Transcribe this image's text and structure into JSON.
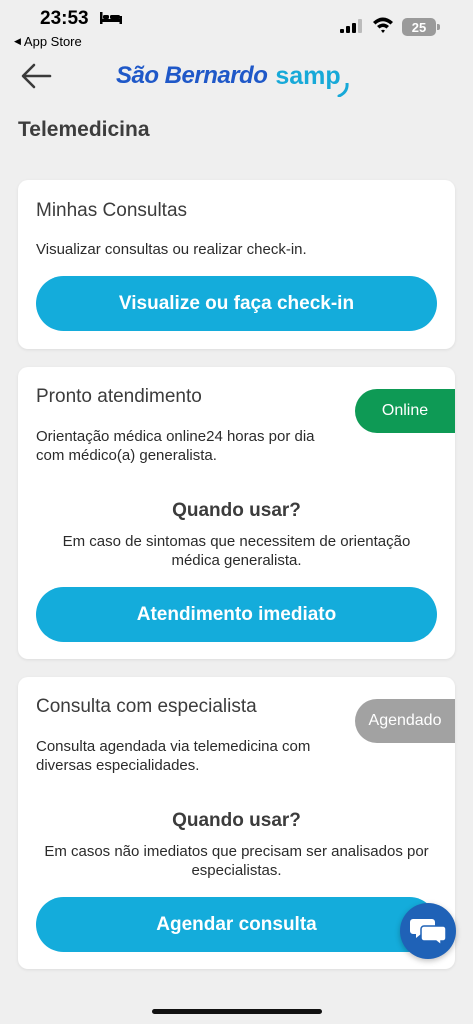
{
  "status_bar": {
    "time": "23:53",
    "back_label": "App Store",
    "battery": "25"
  },
  "header": {
    "logo_part1": "São Bernardo",
    "logo_part2": "samp"
  },
  "page": {
    "title": "Telemedicina"
  },
  "cards": [
    {
      "title": "Minhas Consultas",
      "description": "Visualizar consultas ou realizar check-in.",
      "button": "Visualize ou faça check-in"
    },
    {
      "title": "Pronto atendimento",
      "badge": "Online",
      "description": "Orientação médica online24 horas por dia com médico(a) generalista.",
      "when_title": "Quando usar?",
      "when_text": "Em caso de sintomas que necessitem de orientação médica generalista.",
      "button": "Atendimento imediato"
    },
    {
      "title": "Consulta com especialista",
      "badge": "Agendado",
      "description": "Consulta agendada via telemedicina com diversas especialidades.",
      "when_title": "Quando usar?",
      "when_text": "Em casos não imediatos que precisam ser analisados por especialistas.",
      "button": "Agendar consulta"
    }
  ],
  "colors": {
    "primary_button": "#14acdb",
    "online_badge": "#0e9a55",
    "scheduled_badge": "#a2a2a2",
    "logo_blue": "#1f58c8",
    "logo_cyan": "#17a9d8",
    "chat_button": "#1f62b7"
  },
  "icons": {
    "back": "arrow-left-icon",
    "chat": "chat-bubbles-icon",
    "sleep": "bed-icon",
    "signal": "cellular-signal-icon",
    "wifi": "wifi-icon"
  }
}
